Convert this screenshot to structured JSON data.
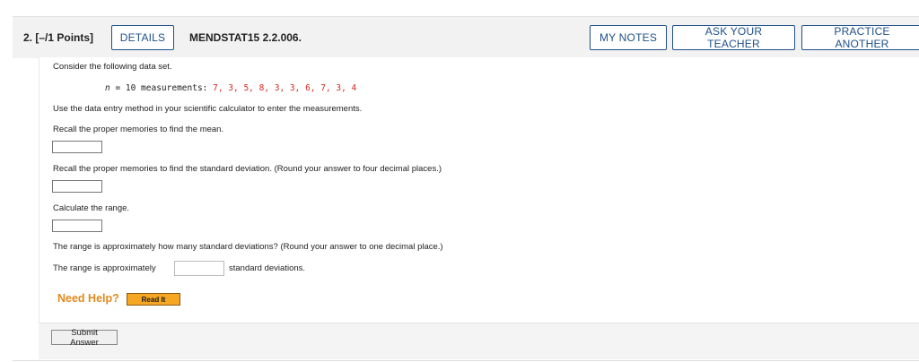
{
  "header": {
    "question_number": "2. [–/1 Points]",
    "details_label": "DETAILS",
    "problem_code": "MENDSTAT15 2.2.006.",
    "my_notes_label": "MY NOTES",
    "ask_teacher_label": "ASK YOUR TEACHER",
    "practice_another_label": "PRACTICE ANOTHER"
  },
  "question": {
    "intro": "Consider the following data set.",
    "n_label": "n",
    "n_rest": " = 10 measurements: ",
    "data_values": "7, 3, 5, 8, 3, 3, 6, 7, 3, 4",
    "instruction": "Use the data entry method in your scientific calculator to enter the measurements.",
    "part1": "Recall the proper memories to find the mean.",
    "part2": "Recall the proper memories to find the standard deviation. (Round your answer to four decimal places.)",
    "part3": "Calculate the range.",
    "part4": "The range is approximately how many standard deviations? (Round your answer to one decimal place.)",
    "range_prefix": "The range is approximately",
    "range_suffix": "standard deviations."
  },
  "help": {
    "need_help": "Need Help?",
    "read_it": "Read It"
  },
  "footer": {
    "submit_label": "Submit Answer"
  },
  "colors": {
    "accent_blue": "#1f4f8a",
    "data_red": "#d6281e",
    "help_orange": "#e08a1e",
    "read_it_bg": "#f5a623"
  }
}
